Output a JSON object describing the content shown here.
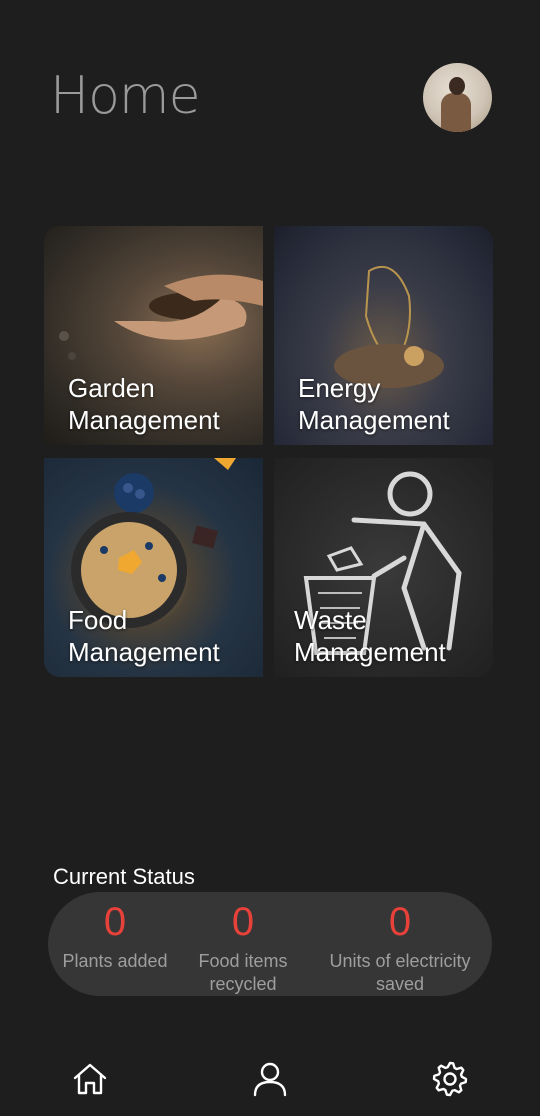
{
  "header": {
    "title": "Home"
  },
  "tiles": [
    {
      "label_line1": "Garden",
      "label_line2": "Management"
    },
    {
      "label_line1": "Energy",
      "label_line2": "Management"
    },
    {
      "label_line1": "Food",
      "label_line2": "Management"
    },
    {
      "label_line1": "Waste",
      "label_line2": "Management"
    }
  ],
  "status": {
    "title": "Current Status",
    "items": [
      {
        "value": "0",
        "label_line1": "Plants added",
        "label_line2": ""
      },
      {
        "value": "0",
        "label_line1": "Food items",
        "label_line2": "recycled"
      },
      {
        "value": "0",
        "label_line1": "Units of electricity",
        "label_line2": "saved"
      }
    ]
  },
  "nav": {
    "icons": [
      "home-icon",
      "user-icon",
      "gear-icon"
    ]
  },
  "colors": {
    "background": "#1e1e1e",
    "status_value": "#e8413a",
    "status_bar": "#363636"
  }
}
